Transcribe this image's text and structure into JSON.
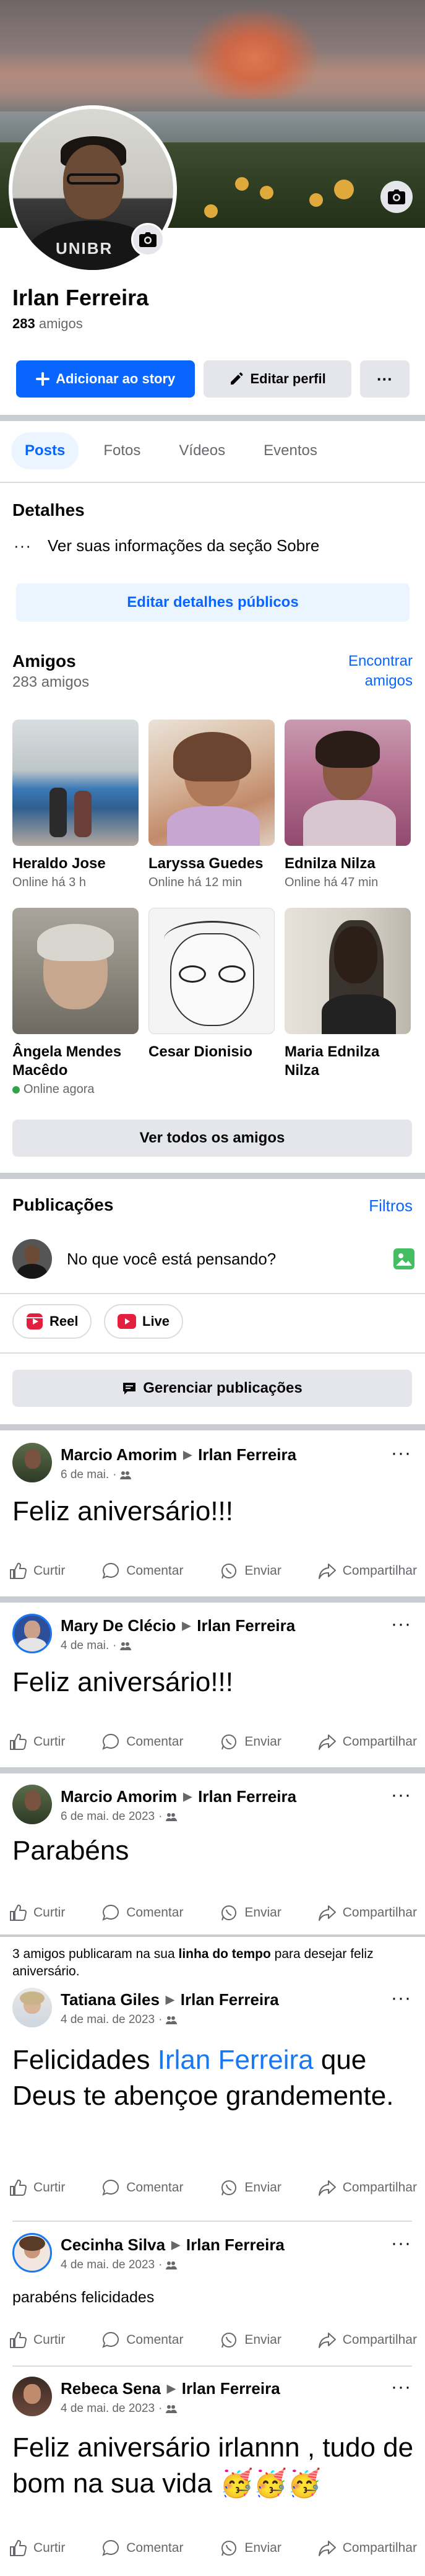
{
  "profile": {
    "name": "Irlan Ferreira",
    "friend_count_number": "283",
    "friend_count_label": "amigos",
    "avatar_shirt_text": "UNIBR"
  },
  "actions": {
    "add_story": "Adicionar ao story",
    "edit_profile": "Editar perfil",
    "more": "···"
  },
  "tabs": [
    "Posts",
    "Fotos",
    "Vídeos",
    "Eventos"
  ],
  "details": {
    "title": "Detalhes",
    "about_link": "Ver suas informações da seção Sobre",
    "edit_public": "Editar detalhes públicos"
  },
  "friends": {
    "title": "Amigos",
    "subtitle": "283 amigos",
    "find_line1": "Encontrar",
    "find_line2": "amigos",
    "see_all": "Ver todos os amigos",
    "list": [
      {
        "name": "Heraldo Jose",
        "status": "Online há 3 h"
      },
      {
        "name": "Laryssa Guedes",
        "status": "Online há 12 min"
      },
      {
        "name": "Ednilza Nilza",
        "status": "Online há 47 min"
      },
      {
        "name": "Ângela Mendes Macêdo",
        "status": "Online agora"
      },
      {
        "name": "Cesar Dionisio",
        "status": ""
      },
      {
        "name": "Maria Ednilza Nilza",
        "status": ""
      }
    ]
  },
  "publications": {
    "title": "Publicações",
    "filters": "Filtros",
    "composer_prompt": "No que você está pensando?",
    "reel": "Reel",
    "live": "Live",
    "manage": "Gerenciar publicações"
  },
  "post_actions": {
    "like": "Curtir",
    "comment": "Comentar",
    "send": "Enviar",
    "share": "Compartilhar"
  },
  "timeline_note": {
    "prefix": "3 amigos publicaram na sua ",
    "bold": "linha do tempo",
    "suffix": " para desejar feliz aniversário."
  },
  "posts": [
    {
      "author": "Marcio Amorim",
      "target": "Irlan Ferreira",
      "date": "6 de mai.",
      "text": "Feliz aniversário!!!"
    },
    {
      "author": "Mary De Clécio",
      "target": "Irlan Ferreira",
      "date": "4 de mai.",
      "text": "Feliz aniversário!!!"
    },
    {
      "author": "Marcio Amorim",
      "target": "Irlan Ferreira",
      "date": "6 de mai. de 2023",
      "text": "Parabéns"
    },
    {
      "author": "Tatiana Giles",
      "target": "Irlan Ferreira",
      "date": "4 de mai. de 2023",
      "text_before": "Felicidades ",
      "mention": "Irlan Ferreira",
      "text_after": " que Deus te abençoe grandemente."
    },
    {
      "author": "Cecinha Silva",
      "target": "Irlan Ferreira",
      "date": "4 de mai. de 2023",
      "text": "parabéns felicidades"
    },
    {
      "author": "Rebeca Sena",
      "target": "Irlan Ferreira",
      "date": "4 de mai. de 2023",
      "text": "Feliz aniversário irlannn , tudo de bom na sua vida 🥳🥳🥳"
    }
  ],
  "colors": {
    "primary": "#0866ff",
    "link": "#1877f2",
    "secondary_bg": "#e4e6eb",
    "muted_text": "#65676b",
    "online": "#31a24c"
  },
  "icons": {
    "camera": "camera-icon",
    "pencil": "pencil-icon",
    "plus": "plus-icon",
    "dots": "more-dots-icon",
    "like": "thumbs-up-icon",
    "comment": "comment-bubble-icon",
    "send": "whatsapp-send-icon",
    "share": "share-arrow-icon",
    "audience": "friends-audience-icon"
  }
}
